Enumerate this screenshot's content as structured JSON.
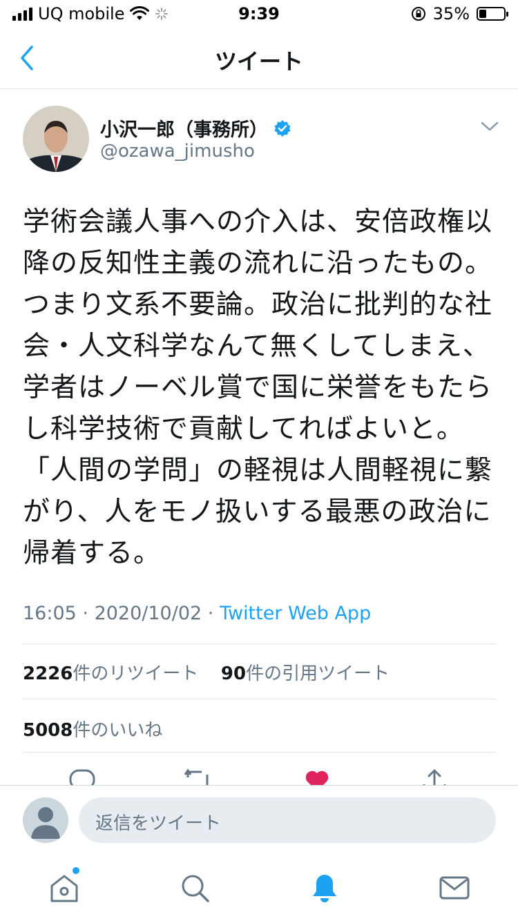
{
  "status_bar": {
    "carrier": "UQ mobile",
    "time": "9:39",
    "battery": "35%"
  },
  "nav": {
    "title": "ツイート"
  },
  "tweet": {
    "author_name": "小沢一郎（事務所）",
    "author_handle": "@ozawa_jimusho",
    "text": "学術会議人事への介入は、安倍政権以\n降の反知性主義の流れに沿ったもの。\nつまり文系不要論。政治に批判的な社\n会・人文科学なんて無くしてしまえ、\n学者はノーベル賞で国に栄誉をもたら\nし科学技術で貢献してればよいと。\n「人間の学問」の軽視は人間軽視に繋\nがり、人をモノ扱いする最悪の政治に\n帰着する。",
    "time": "16:05",
    "date": "2020/10/02",
    "source": "Twitter Web App",
    "retweets_count": "2226",
    "retweets_label": "件のリツイート",
    "quotes_count": "90",
    "quotes_label": "件の引用ツイート",
    "likes_count": "5008",
    "likes_label": "件のいいね"
  },
  "reply": {
    "placeholder": "返信をツイート"
  },
  "colors": {
    "accent": "#1da1f2",
    "like": "#e0245e",
    "muted": "#657786"
  },
  "tab_bar": {
    "items": [
      "home-icon",
      "search-icon",
      "notifications-icon",
      "messages-icon"
    ],
    "active": "notifications-icon"
  }
}
